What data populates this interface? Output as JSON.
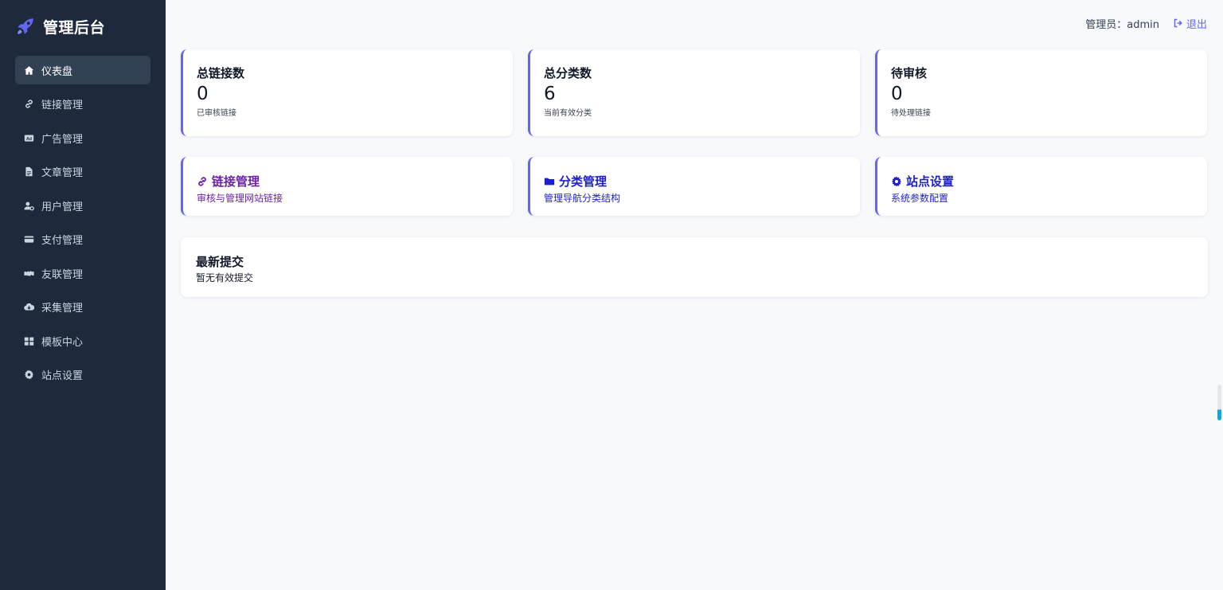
{
  "brand": {
    "title": "管理后台",
    "icon": "rocket-icon"
  },
  "sidebar": {
    "items": [
      {
        "label": "仪表盘",
        "icon": "home-icon",
        "active": true
      },
      {
        "label": "链接管理",
        "icon": "link-icon"
      },
      {
        "label": "广告管理",
        "icon": "ad-icon"
      },
      {
        "label": "文章管理",
        "icon": "file-icon"
      },
      {
        "label": "用户管理",
        "icon": "user-cog-icon"
      },
      {
        "label": "支付管理",
        "icon": "credit-card-icon"
      },
      {
        "label": "友联管理",
        "icon": "handshake-icon"
      },
      {
        "label": "采集管理",
        "icon": "cloud-download-icon"
      },
      {
        "label": "模板中心",
        "icon": "grid-icon"
      },
      {
        "label": "站点设置",
        "icon": "gear-icon"
      }
    ]
  },
  "topbar": {
    "admin_label": "管理员：admin",
    "logout_label": "退出"
  },
  "stats": [
    {
      "label": "总链接数",
      "value": "0",
      "sub": "已审核链接"
    },
    {
      "label": "总分类数",
      "value": "6",
      "sub": "当前有效分类"
    },
    {
      "label": "待审核",
      "value": "0",
      "sub": "待处理链接"
    }
  ],
  "quick": [
    {
      "title": "链接管理",
      "sub": "审核与管理网站链接",
      "icon": "link-icon"
    },
    {
      "title": "分类管理",
      "sub": "管理导航分类结构",
      "icon": "folder-icon"
    },
    {
      "title": "站点设置",
      "sub": "系统参数配置",
      "icon": "gear-icon"
    }
  ],
  "recent": {
    "title": "最新提交",
    "empty_text": "暂无有效提交"
  },
  "colors": {
    "sidebar_bg": "#1e293b",
    "accent": "#6366f1",
    "purple": "#6b21a8",
    "blue": "#1d1dd4"
  }
}
